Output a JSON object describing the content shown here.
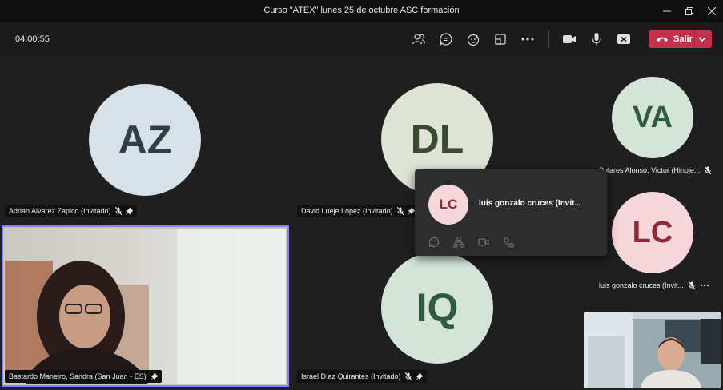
{
  "window": {
    "title": "Curso \"ATEX\" lunes 25 de octubre ASC formación",
    "minimize_icon": "minimize-icon",
    "maximize_icon": "maximize-icon",
    "close_icon": "close-icon"
  },
  "toolbar": {
    "timer": "04:00:55",
    "icons": [
      "participants-icon",
      "chat-icon",
      "reactions-icon",
      "share-tray-icon",
      "more-options-icon",
      "camera-icon",
      "microphone-icon",
      "share-screen-icon"
    ],
    "leave_label": "Salir",
    "leave_color": "#c4314b"
  },
  "participants": [
    {
      "initials": "AZ",
      "name": "Adrian Alvarez Zapico (Invitado)",
      "muted": true,
      "pinned": true
    },
    {
      "initials": "DL",
      "name": "David Lueje Lopez (Invitado)",
      "muted": true,
      "pinned": true
    },
    {
      "initials": "VA",
      "name": "Solares Alonso, Victor (Hinoje...",
      "muted": true,
      "pinned": false
    },
    {
      "initials": "LC",
      "name": "luis gonzalo cruces (Invit...",
      "muted": true,
      "pinned": false
    },
    {
      "initials": "IQ",
      "name": "Israel Díaz Quirantes (Invitado)",
      "muted": true,
      "pinned": true
    },
    {
      "initials": "",
      "name": "Bastardo Maneiro, Sandra (San Juan - ES)",
      "muted": false,
      "pinned": true
    }
  ],
  "hover_card": {
    "initials": "LC",
    "name": "luis gonzalo cruces (Invit...",
    "actions": [
      "chat-icon",
      "org-chart-icon",
      "video-call-icon",
      "audio-call-icon"
    ]
  },
  "colors": {
    "accent": "#7f85f5",
    "stage_bg": "#1f1f1f"
  }
}
